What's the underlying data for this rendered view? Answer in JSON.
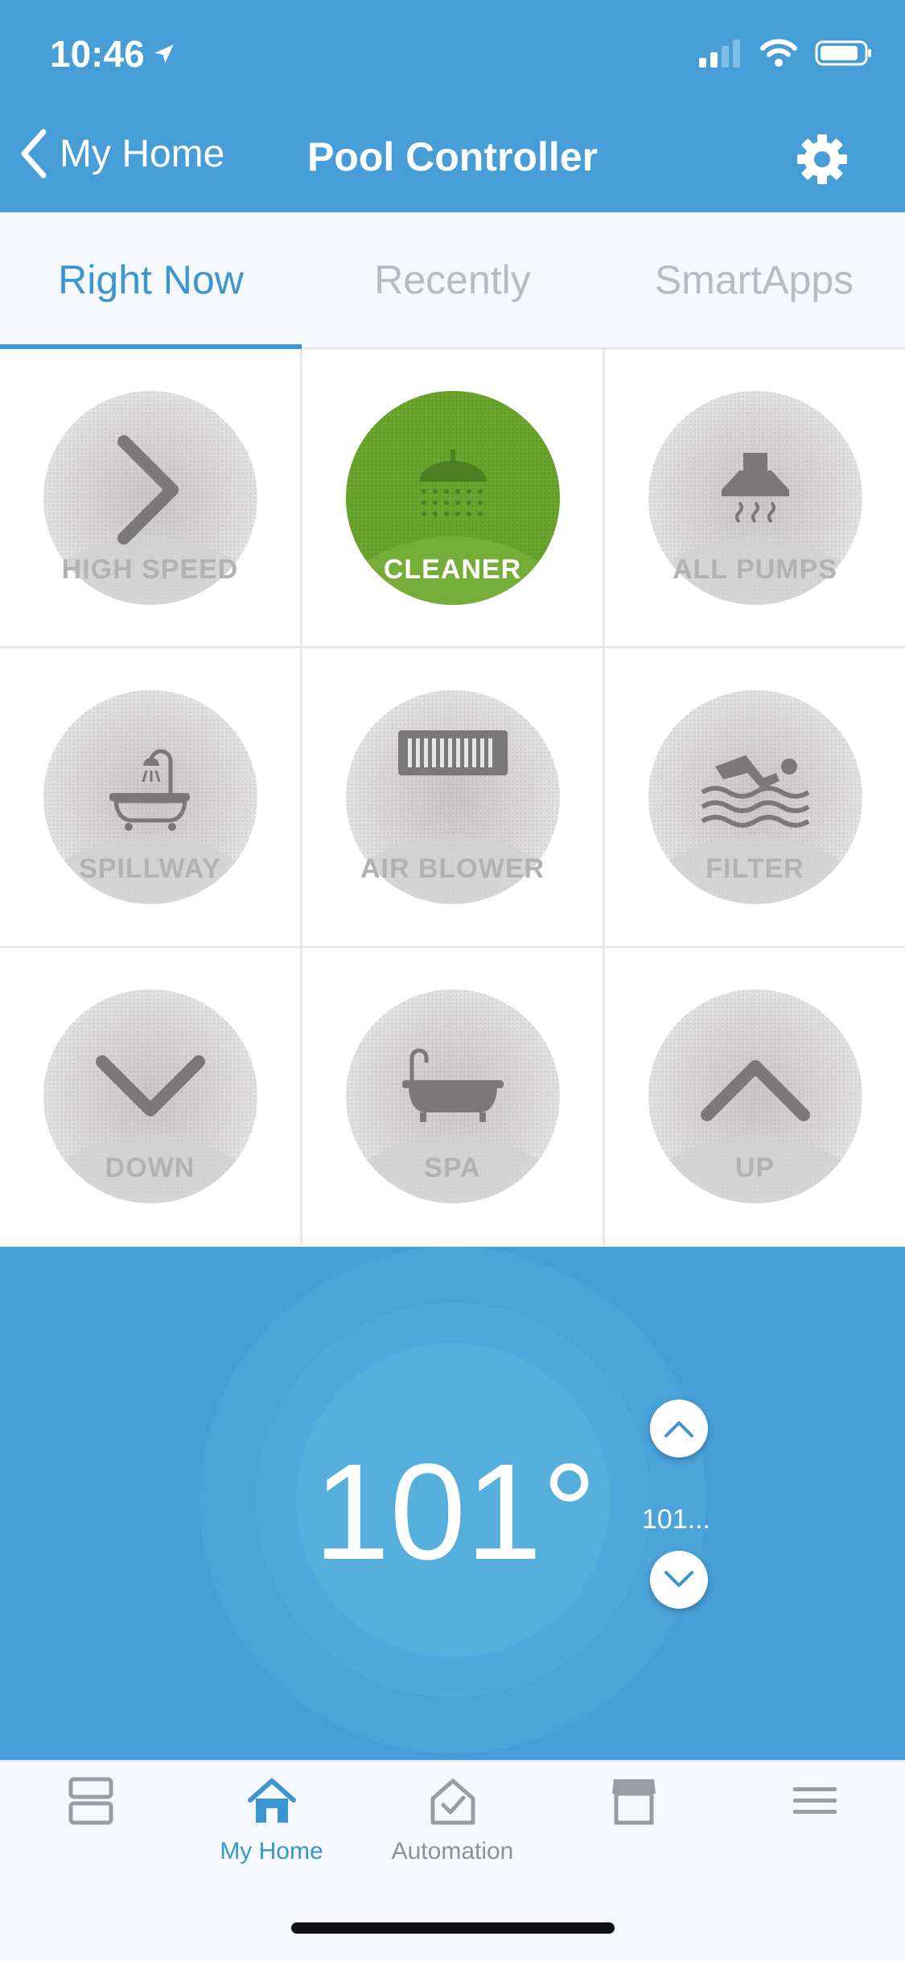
{
  "status_bar": {
    "time": "10:46"
  },
  "nav": {
    "back_label": "My Home",
    "title": "Pool Controller"
  },
  "tabs": [
    {
      "label": "Right Now",
      "active": true
    },
    {
      "label": "Recently",
      "active": false
    },
    {
      "label": "SmartApps",
      "active": false
    }
  ],
  "tiles": [
    {
      "label": "HIGH SPEED",
      "icon": "chevron-right-icon",
      "on": false
    },
    {
      "label": "CLEANER",
      "icon": "shower-head-icon",
      "on": true
    },
    {
      "label": "ALL PUMPS",
      "icon": "range-hood-icon",
      "on": false
    },
    {
      "label": "SPILLWAY",
      "icon": "bathtub-shower-icon",
      "on": false
    },
    {
      "label": "AIR BLOWER",
      "icon": "vent-grille-icon",
      "on": false
    },
    {
      "label": "FILTER",
      "icon": "swimmer-icon",
      "on": false
    },
    {
      "label": "DOWN",
      "icon": "chevron-down-icon",
      "on": false
    },
    {
      "label": "SPA",
      "icon": "bathtub-icon",
      "on": false
    },
    {
      "label": "UP",
      "icon": "chevron-up-icon",
      "on": false
    }
  ],
  "thermostat": {
    "temperature": "101°",
    "setpoint": "101..."
  },
  "bottom_nav": [
    {
      "label": "",
      "icon": "dashboard-icon",
      "active": false
    },
    {
      "label": "My Home",
      "icon": "home-icon",
      "active": true
    },
    {
      "label": "Automation",
      "icon": "automation-icon",
      "active": false
    },
    {
      "label": "",
      "icon": "marketplace-icon",
      "active": false
    },
    {
      "label": "",
      "icon": "menu-icon",
      "active": false
    }
  ],
  "colors": {
    "header_blue": "#479ed7",
    "accent_blue": "#3b95d2",
    "active_green": "#6ba52d"
  }
}
